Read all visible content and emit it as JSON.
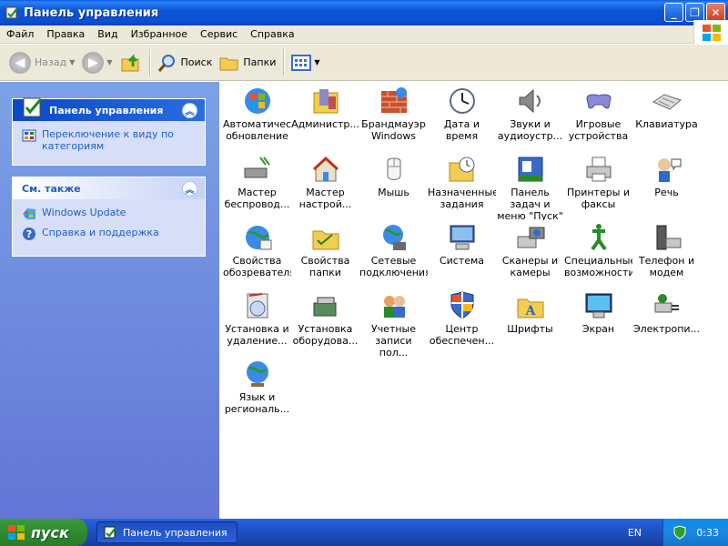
{
  "window": {
    "title": "Панель управления"
  },
  "menu": [
    "Файл",
    "Правка",
    "Вид",
    "Избранное",
    "Сервис",
    "Справка"
  ],
  "toolbar": {
    "back": "Назад",
    "search": "Поиск",
    "folders": "Папки"
  },
  "taskpane": {
    "panel_title": "Панель управления",
    "switch_link": "Переключение к виду по категориям",
    "see_also_title": "См. также",
    "links": [
      "Windows Update",
      "Справка и поддержка"
    ]
  },
  "items": [
    {
      "label": "Автоматическое обновление",
      "icon": "auto-update-icon"
    },
    {
      "label": "Администр...",
      "icon": "admin-tools-icon"
    },
    {
      "label": "Брандмауэр Windows",
      "icon": "firewall-icon"
    },
    {
      "label": "Дата и время",
      "icon": "date-time-icon"
    },
    {
      "label": "Звуки и аудиоустр...",
      "icon": "sound-icon"
    },
    {
      "label": "Игровые устройства",
      "icon": "game-controller-icon"
    },
    {
      "label": "Клавиатура",
      "icon": "keyboard-icon"
    },
    {
      "label": "Мастер беспровод...",
      "icon": "wireless-wizard-icon"
    },
    {
      "label": "Мастер настрой...",
      "icon": "network-wizard-icon"
    },
    {
      "label": "Мышь",
      "icon": "mouse-icon"
    },
    {
      "label": "Назначенные задания",
      "icon": "scheduled-tasks-icon"
    },
    {
      "label": "Панель задач и меню \"Пуск\"",
      "icon": "taskbar-start-icon"
    },
    {
      "label": "Принтеры и факсы",
      "icon": "printer-icon"
    },
    {
      "label": "Речь",
      "icon": "speech-icon"
    },
    {
      "label": "Свойства обозревателя",
      "icon": "internet-options-icon"
    },
    {
      "label": "Свойства папки",
      "icon": "folder-options-icon"
    },
    {
      "label": "Сетевые подключения",
      "icon": "network-connections-icon"
    },
    {
      "label": "Система",
      "icon": "system-icon"
    },
    {
      "label": "Сканеры и камеры",
      "icon": "scanner-camera-icon"
    },
    {
      "label": "Специальные возможности",
      "icon": "accessibility-icon"
    },
    {
      "label": "Телефон и модем",
      "icon": "phone-modem-icon"
    },
    {
      "label": "Установка и удаление...",
      "icon": "add-remove-programs-icon"
    },
    {
      "label": "Установка оборудова...",
      "icon": "add-hardware-icon"
    },
    {
      "label": "Учетные записи пол...",
      "icon": "user-accounts-icon"
    },
    {
      "label": "Центр обеспечен...",
      "icon": "security-center-icon"
    },
    {
      "label": "Шрифты",
      "icon": "fonts-icon"
    },
    {
      "label": "Экран",
      "icon": "display-icon"
    },
    {
      "label": "Электропи...",
      "icon": "power-options-icon"
    },
    {
      "label": "Язык и региональ...",
      "icon": "regional-language-icon"
    }
  ],
  "taskbar": {
    "start": "пуск",
    "task": "Панель управления",
    "lang": "EN",
    "time": "0:33"
  }
}
